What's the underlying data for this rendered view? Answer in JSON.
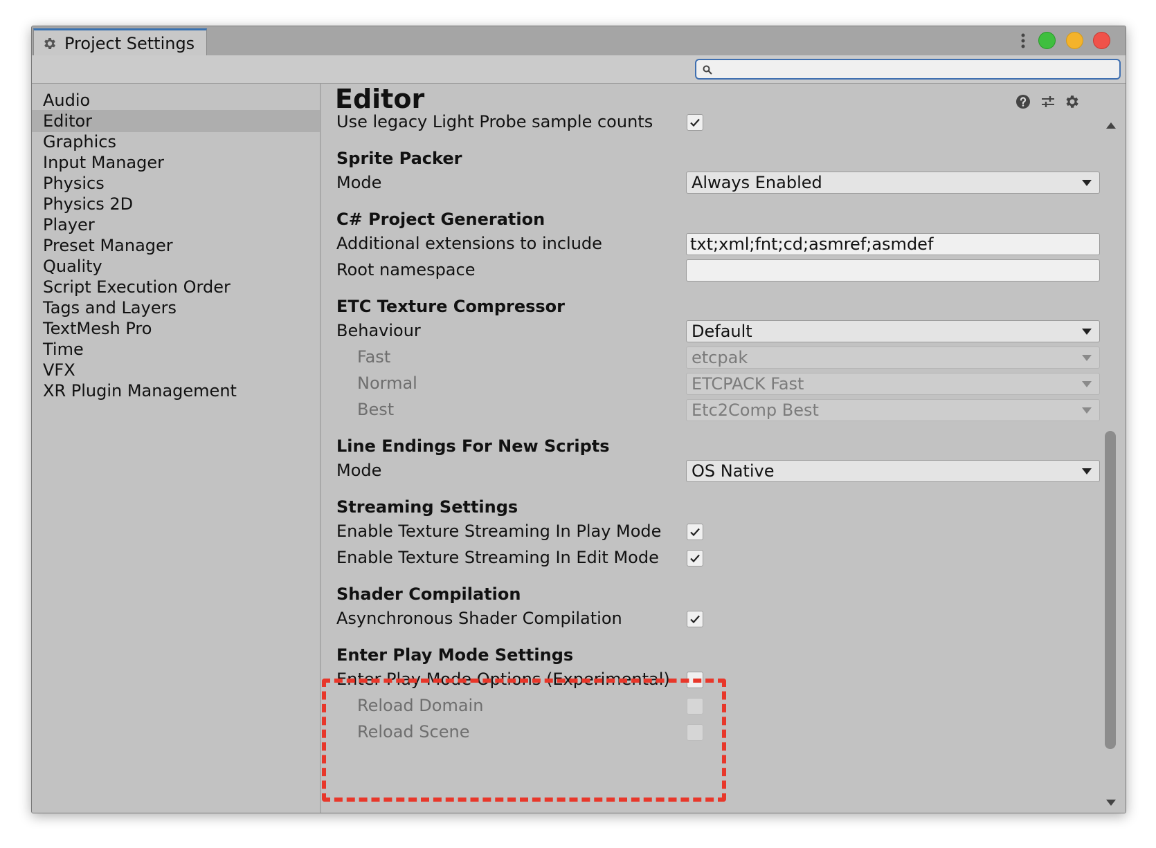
{
  "window": {
    "tab_title": "Project Settings",
    "accent_color": "#3a72b0",
    "traffic_lights": [
      "#3fbf3f",
      "#f4b32b",
      "#f0524a"
    ]
  },
  "search": {
    "placeholder": "",
    "value": ""
  },
  "sidebar": {
    "items": [
      {
        "label": "Audio"
      },
      {
        "label": "Editor",
        "selected": true
      },
      {
        "label": "Graphics"
      },
      {
        "label": "Input Manager"
      },
      {
        "label": "Physics"
      },
      {
        "label": "Physics 2D"
      },
      {
        "label": "Player"
      },
      {
        "label": "Preset Manager"
      },
      {
        "label": "Quality"
      },
      {
        "label": "Script Execution Order"
      },
      {
        "label": "Tags and Layers"
      },
      {
        "label": "TextMesh Pro"
      },
      {
        "label": "Time"
      },
      {
        "label": "VFX"
      },
      {
        "label": "XR Plugin Management"
      }
    ]
  },
  "main": {
    "title": "Editor",
    "header_icons": [
      "help-icon",
      "preset-sliders-icon",
      "gear-icon"
    ],
    "legacy_light_probe": {
      "label": "Use legacy Light Probe sample counts",
      "checked": true
    },
    "sprite_packer": {
      "heading": "Sprite Packer",
      "mode_label": "Mode",
      "mode_value": "Always Enabled"
    },
    "csharp_project": {
      "heading": "C# Project Generation",
      "extensions_label": "Additional extensions to include",
      "extensions_value": "txt;xml;fnt;cd;asmref;asmdef",
      "namespace_label": "Root namespace",
      "namespace_value": ""
    },
    "etc_compressor": {
      "heading": "ETC Texture Compressor",
      "behaviour_label": "Behaviour",
      "behaviour_value": "Default",
      "fast_label": "Fast",
      "fast_value": "etcpak",
      "normal_label": "Normal",
      "normal_value": "ETCPACK Fast",
      "best_label": "Best",
      "best_value": "Etc2Comp Best"
    },
    "line_endings": {
      "heading": "Line Endings For New Scripts",
      "mode_label": "Mode",
      "mode_value": "OS Native"
    },
    "streaming": {
      "heading": "Streaming Settings",
      "play_mode_label": "Enable Texture Streaming In Play Mode",
      "play_mode_checked": true,
      "edit_mode_label": "Enable Texture Streaming In Edit Mode",
      "edit_mode_checked": true
    },
    "shader": {
      "heading": "Shader Compilation",
      "async_label": "Asynchronous Shader Compilation",
      "async_checked": true
    },
    "enter_play_mode": {
      "heading": "Enter Play Mode Settings",
      "options_label": "Enter Play Mode Options (Experimental)",
      "options_checked": false,
      "reload_domain_label": "Reload Domain",
      "reload_domain_checked": false,
      "reload_scene_label": "Reload Scene",
      "reload_scene_checked": false,
      "highlight_color": "#e8372a"
    }
  }
}
